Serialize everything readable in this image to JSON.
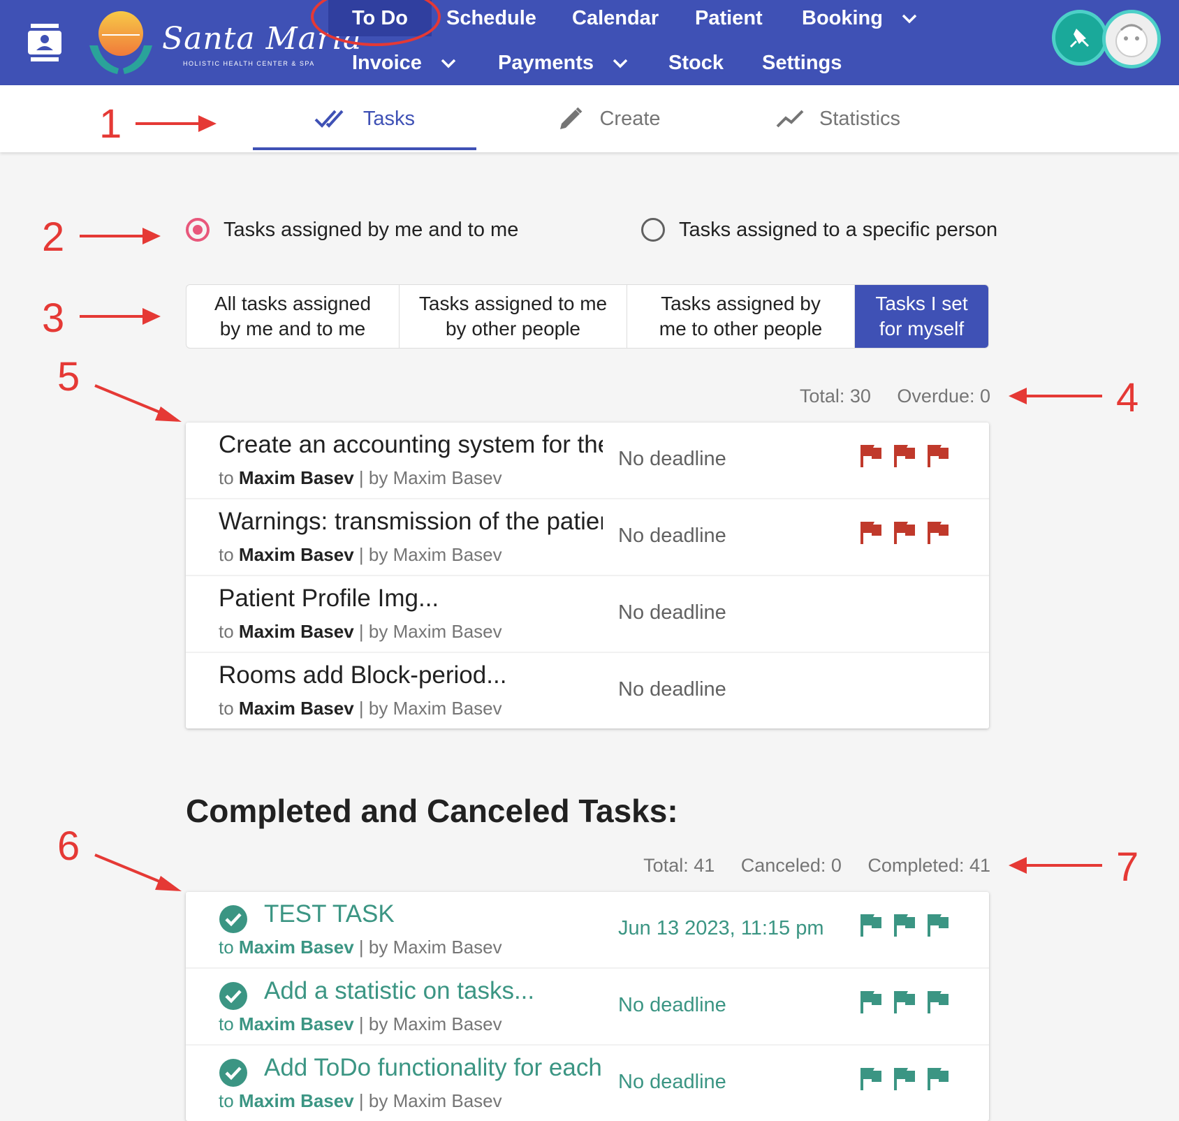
{
  "nav": {
    "brand_name": "Santa Maria",
    "brand_tagline": "HOLISTIC HEALTH CENTER & SPA",
    "row1": [
      {
        "label": "To Do",
        "active": true
      },
      {
        "label": "Schedule"
      },
      {
        "label": "Calendar"
      },
      {
        "label": "Patient"
      },
      {
        "label": "Booking",
        "dropdown": true
      }
    ],
    "row2": [
      {
        "label": "Invoice",
        "dropdown": true
      },
      {
        "label": "Payments",
        "dropdown": true
      },
      {
        "label": "Stock"
      },
      {
        "label": "Settings"
      }
    ]
  },
  "tabs": [
    {
      "label": "Tasks",
      "icon": "double-check-icon",
      "active": true
    },
    {
      "label": "Create",
      "icon": "pencil-icon"
    },
    {
      "label": "Statistics",
      "icon": "trend-line-icon"
    }
  ],
  "filters": {
    "radio_1": "Tasks assigned by me and to me",
    "radio_2": "Tasks assigned to a specific person",
    "selected_radio": 1
  },
  "segments": [
    {
      "line1": "All tasks assigned",
      "line2": "by me and to me"
    },
    {
      "line1": "Tasks assigned to me",
      "line2": "by other people"
    },
    {
      "line1": "Tasks assigned by",
      "line2": "me to other people"
    },
    {
      "line1": "Tasks I set",
      "line2": "for myself",
      "active": true
    }
  ],
  "active_stats": {
    "total": "Total: 30",
    "overdue": "Overdue: 0"
  },
  "active_tasks": [
    {
      "title": "Create an accounting system for the",
      "to_prefix": "to ",
      "to": "Maxim Basev",
      "by": " | by Maxim Basev",
      "deadline": "No deadline",
      "flags": 3
    },
    {
      "title": "Warnings: transmission of the patient",
      "to_prefix": "to ",
      "to": "Maxim Basev",
      "by": " | by Maxim Basev",
      "deadline": "No deadline",
      "flags": 3
    },
    {
      "title": "Patient Profile Img...",
      "to_prefix": "to ",
      "to": "Maxim Basev",
      "by": " | by Maxim Basev",
      "deadline": "No deadline",
      "flags": 0
    },
    {
      "title": "Rooms add Block-period...",
      "to_prefix": "to ",
      "to": "Maxim Basev",
      "by": " | by Maxim Basev",
      "deadline": "No deadline",
      "flags": 0
    }
  ],
  "completed_section": {
    "title": "Completed and Canceled Tasks:",
    "total": "Total: 41",
    "canceled": "Canceled: 0",
    "completed": "Completed: 41"
  },
  "completed_tasks": [
    {
      "title": "TEST TASK",
      "to_prefix": "to ",
      "to": "Maxim Basev",
      "by": " | by Maxim Basev",
      "deadline": "Jun 13 2023, 11:15 pm",
      "flags": 3
    },
    {
      "title": "Add a statistic on tasks...",
      "to_prefix": "to ",
      "to": "Maxim Basev",
      "by": " | by Maxim Basev",
      "deadline": "No deadline",
      "flags": 3
    },
    {
      "title": "Add ToDo functionality for each",
      "to_prefix": "to ",
      "to": "Maxim Basev",
      "by": " | by Maxim Basev",
      "deadline": "No deadline",
      "flags": 3
    }
  ],
  "annotations": [
    "1",
    "2",
    "3",
    "4",
    "5",
    "6",
    "7"
  ],
  "colors": {
    "header": "#3f51b5",
    "active_nav": "#303f9f",
    "radio": "#e8577b",
    "flag_priority": "#c0392b",
    "flag_done": "#3b9583",
    "annotation": "#e53935"
  }
}
